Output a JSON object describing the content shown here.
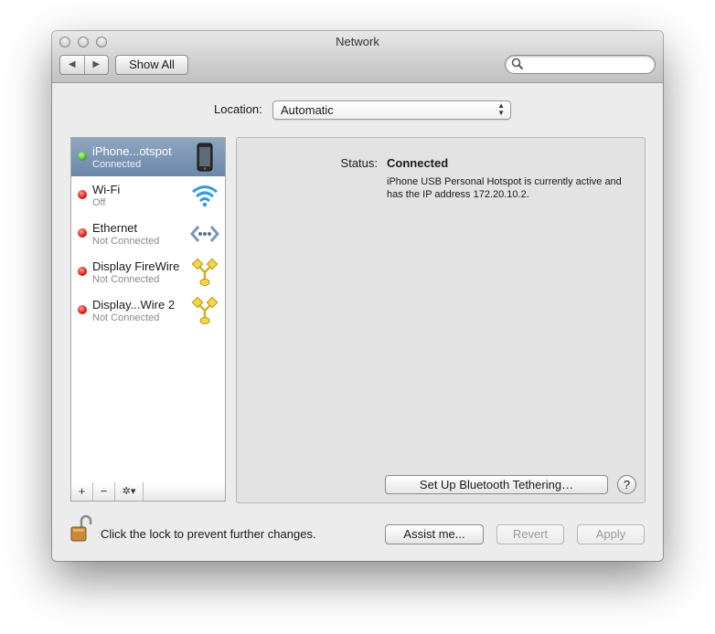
{
  "window": {
    "title": "Network"
  },
  "toolbar": {
    "back_icon": "◀",
    "forward_icon": "▶",
    "show_all_label": "Show All",
    "search_placeholder": ""
  },
  "location": {
    "label": "Location:",
    "value": "Automatic"
  },
  "services": [
    {
      "name": "iPhone...otspot",
      "status": "Connected",
      "indicator": "green",
      "icon": "iphone-icon",
      "selected": true
    },
    {
      "name": "Wi-Fi",
      "status": "Off",
      "indicator": "red",
      "icon": "wifi-icon",
      "selected": false
    },
    {
      "name": "Ethernet",
      "status": "Not Connected",
      "indicator": "red",
      "icon": "ethernet-icon",
      "selected": false
    },
    {
      "name": "Display FireWire",
      "status": "Not Connected",
      "indicator": "red",
      "icon": "firewire-icon",
      "selected": false
    },
    {
      "name": "Display...Wire 2",
      "status": "Not Connected",
      "indicator": "red",
      "icon": "firewire-icon",
      "selected": false
    }
  ],
  "sidebar_controls": {
    "add": "+",
    "remove": "−",
    "gear": "✲▾"
  },
  "detail": {
    "status_label": "Status:",
    "status_value": "Connected",
    "description": "iPhone USB Personal Hotspot is currently active and has the IP address 172.20.10.2.",
    "bt_button": "Set Up Bluetooth Tethering…",
    "help": "?"
  },
  "footer": {
    "lock_text": "Click the lock to prevent further changes.",
    "assist": "Assist me...",
    "revert": "Revert",
    "apply": "Apply"
  },
  "colors": {
    "selection": "#7c95b4",
    "status_green": "#45b424",
    "status_red": "#d81d12"
  }
}
